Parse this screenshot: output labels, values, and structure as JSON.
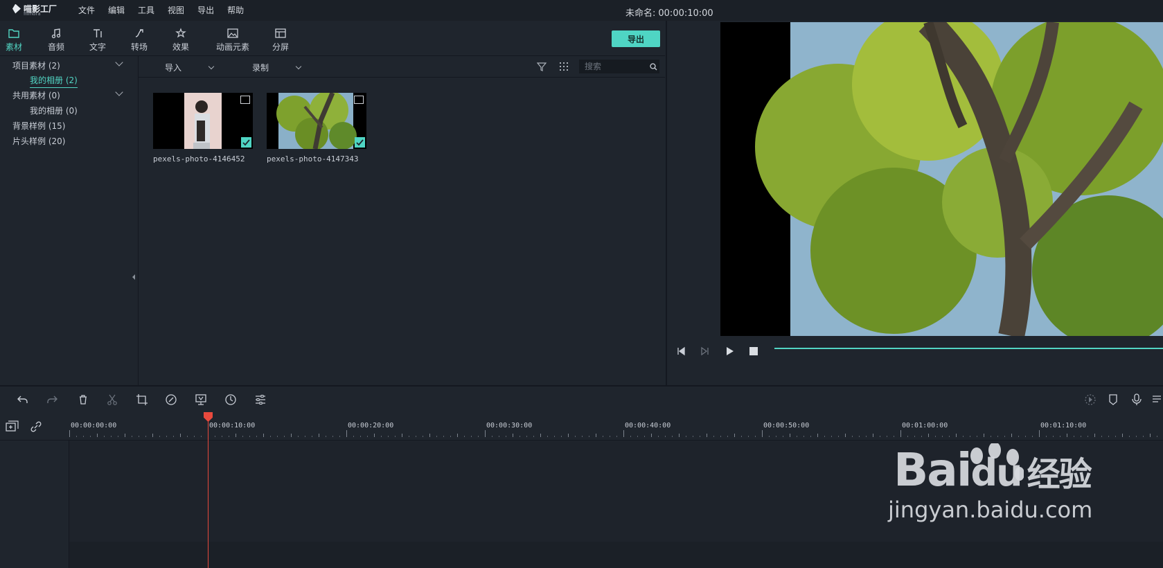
{
  "app": {
    "name": "喵影工厂",
    "subname": "filmora"
  },
  "menu": [
    "文件",
    "编辑",
    "工具",
    "视图",
    "导出",
    "帮助"
  ],
  "project": {
    "name": "未命名:",
    "duration": "00:00:10:00"
  },
  "tabs": [
    {
      "label": "素材",
      "icon": "folder-icon",
      "active": true
    },
    {
      "label": "音频",
      "icon": "music-note-icon"
    },
    {
      "label": "文字",
      "icon": "text-icon"
    },
    {
      "label": "转场",
      "icon": "transition-icon"
    },
    {
      "label": "效果",
      "icon": "effects-icon"
    },
    {
      "label": "动画元素",
      "icon": "image-icon"
    },
    {
      "label": "分屏",
      "icon": "split-screen-icon"
    }
  ],
  "export_label": "导出",
  "sidebar": {
    "items": [
      {
        "label": "项目素材 (2)"
      },
      {
        "label": "我的相册 (2)"
      },
      {
        "label": "共用素材 (0)"
      },
      {
        "label": "我的相册 (0)"
      },
      {
        "label": "背景样例 (15)"
      },
      {
        "label": "片头样例 (20)"
      }
    ]
  },
  "media": {
    "import_label": "导入",
    "record_label": "录制",
    "search_placeholder": "搜索",
    "items": [
      {
        "name": "pexels-photo-4146452"
      },
      {
        "name": "pexels-photo-4147343"
      }
    ]
  },
  "timeline": {
    "ticks": [
      "00:00:00:00",
      "00:00:10:00",
      "00:00:20:00",
      "00:00:30:00",
      "00:00:40:00",
      "00:00:50:00",
      "00:01:00:00",
      "00:01:10:00"
    ]
  },
  "watermark": {
    "brand": "Bai",
    "brand2": "du",
    "suffix": "经验",
    "url": "jingyan.baidu.com"
  },
  "colors": {
    "accent": "#52d6c4",
    "playhead": "#e8493d",
    "background": "#1f252d"
  }
}
